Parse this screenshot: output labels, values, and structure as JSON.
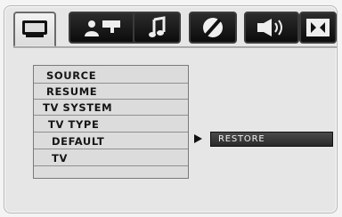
{
  "tabs": [
    {
      "icon": "monitor-icon",
      "label": ""
    },
    {
      "icon": "person-speech-icon",
      "label": ""
    },
    {
      "icon": "music-note-icon",
      "label": ""
    },
    {
      "icon": "circle-slash-icon",
      "label": ""
    },
    {
      "icon": "speaker-icon",
      "label": ""
    },
    {
      "icon": "dolby-icon",
      "label": ""
    }
  ],
  "menu": {
    "items": [
      {
        "label": "SOURCE"
      },
      {
        "label": "RESUME"
      },
      {
        "label": "TV SYSTEM"
      },
      {
        "label": "TV TYPE"
      },
      {
        "label": "DEFAULT"
      },
      {
        "label": "TV"
      }
    ]
  },
  "submenu": {
    "selected_label": "RESTORE"
  }
}
